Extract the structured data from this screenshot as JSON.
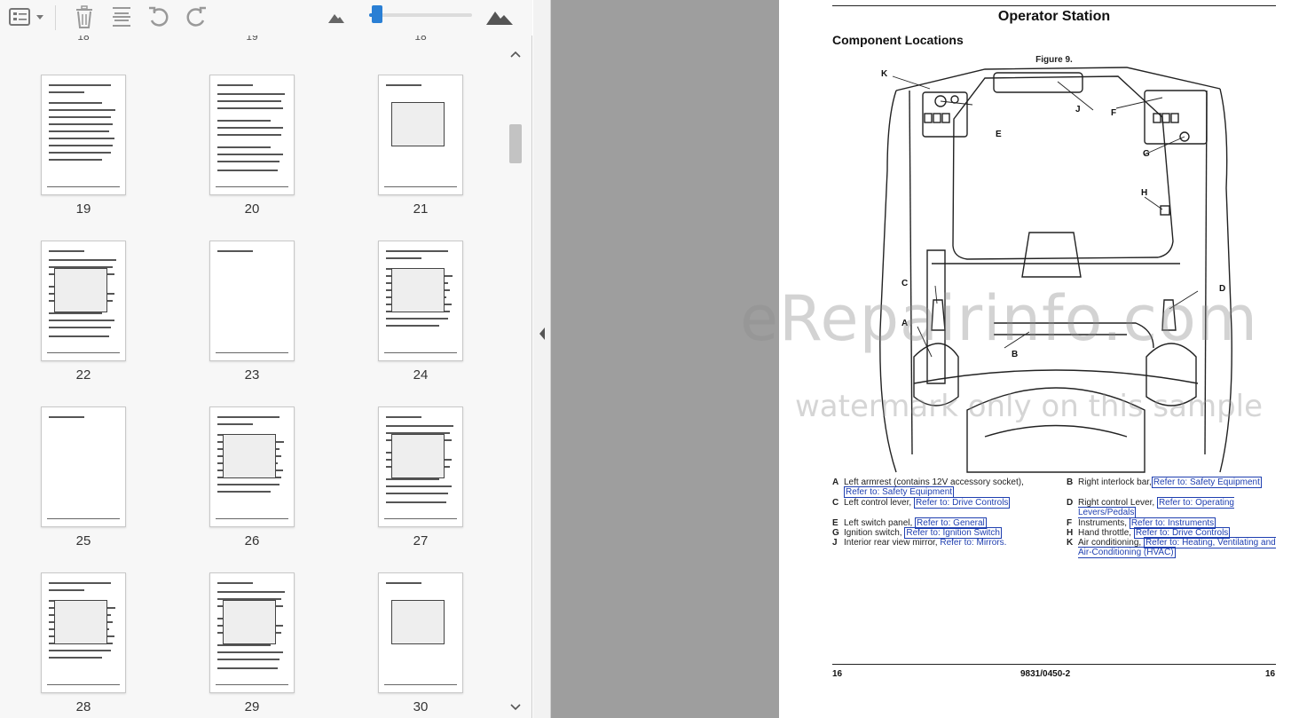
{
  "toolbar": {
    "icons": [
      "thumbnail-menu-icon",
      "chevron-down-icon",
      "trash-icon",
      "rotate-pages-icon",
      "undo-icon",
      "redo-icon",
      "zoom-out-mountain-icon",
      "zoom-in-mountain-icon"
    ],
    "zoom_level": 0.05
  },
  "thumbnails": {
    "partial_top": [
      "18",
      "19",
      "18"
    ],
    "pages": [
      "19",
      "20",
      "21",
      "22",
      "23",
      "24",
      "25",
      "26",
      "27",
      "28",
      "29",
      "30"
    ]
  },
  "document": {
    "title": "Operator Station",
    "subtitle": "Component Locations",
    "figure_label": "Figure 9.",
    "callouts": [
      "K",
      "J",
      "F",
      "E",
      "G",
      "H",
      "C",
      "D",
      "A",
      "B"
    ],
    "legend": [
      {
        "letter": "A",
        "text": "Left armrest (contains 12V accessory socket),",
        "ref": "Refer to: Safety Equipment"
      },
      {
        "letter": "B",
        "text": "Right interlock bar,",
        "ref": "Refer to: Safety Equipment"
      },
      {
        "letter": "C",
        "text": "Left control lever,",
        "ref": "Refer to: Drive Controls"
      },
      {
        "letter": "D",
        "text": "Right control Lever,",
        "ref": "Refer to: Operating Levers/Pedals"
      },
      {
        "letter": "E",
        "text": "Left switch panel,",
        "ref": "Refer to: General"
      },
      {
        "letter": "F",
        "text": "Instruments,",
        "ref": "Refer to: Instruments"
      },
      {
        "letter": "G",
        "text": "Ignition switch,",
        "ref": "Refer to: Ignition Switch"
      },
      {
        "letter": "H",
        "text": "Hand throttle,",
        "ref": "Refer to: Drive Controls"
      },
      {
        "letter": "J",
        "text": "Interior rear view mirror,",
        "ref": "Refer to: Mirrors."
      },
      {
        "letter": "K",
        "text": "Air conditioning,",
        "ref": "Refer to: Heating, Ventilating and Air-Conditioning (HVAC)"
      }
    ],
    "footer": {
      "left": "16",
      "center": "9831/0450-2",
      "right": "16"
    }
  },
  "watermark": {
    "line1": "eRepairinfo.com",
    "line2": "watermark only on this sample"
  },
  "colors": {
    "link": "#1f3fb0",
    "accent": "#2a7fd4",
    "gap": "#9e9e9e"
  }
}
